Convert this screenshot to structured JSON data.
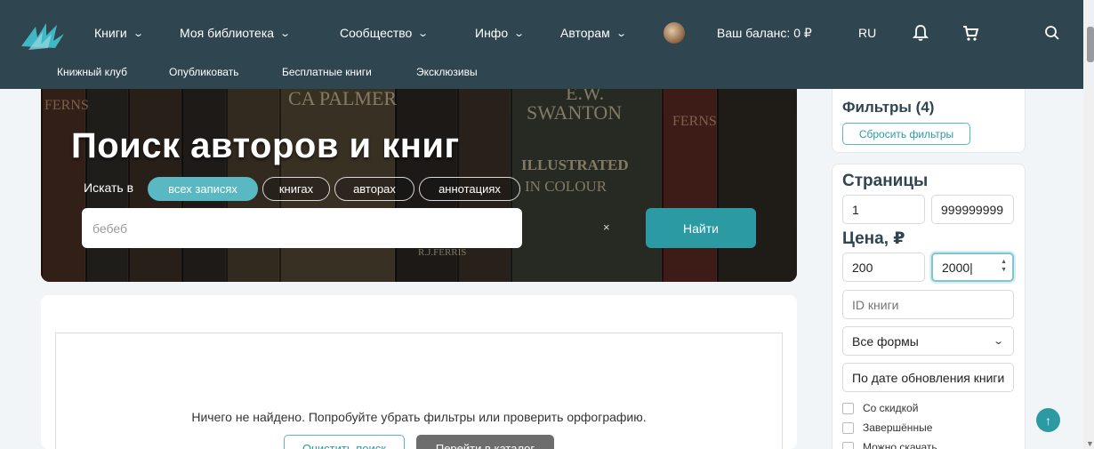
{
  "nav": {
    "items": [
      {
        "label": "Книги"
      },
      {
        "label": "Моя библиотека"
      },
      {
        "label": "Сообщество"
      },
      {
        "label": "Инфо"
      },
      {
        "label": "Авторам"
      }
    ],
    "balance": "Ваш баланс: 0 ₽",
    "lang": "RU"
  },
  "subnav": [
    "Книжный клуб",
    "Опубликовать",
    "Бесплатные книги",
    "Эксклюзивы"
  ],
  "hero": {
    "title": "Поиск авторов и книг",
    "search_in_label": "Искать в",
    "chips": [
      {
        "label": "всех записях",
        "active": true
      },
      {
        "label": "книгах",
        "active": false
      },
      {
        "label": "авторах",
        "active": false
      },
      {
        "label": "аннотациях",
        "active": false
      }
    ],
    "query": "бебеб",
    "clear": "×",
    "find_button": "Найти",
    "book_spines": [
      "CA PALMER",
      "E.W.",
      "SWANTON",
      "ILLUSTRATED",
      "IN COLOUR",
      "FERNS",
      "FERNS",
      "R.J.FERRIS"
    ]
  },
  "results": {
    "empty_message": "Ничего не найдено. Попробуйте убрать фильтры или проверить орфографию.",
    "clear_search": "Очистить поиск",
    "go_catalog": "Перейти в каталог"
  },
  "sidebar": {
    "filters_title": "Фильтры (4)",
    "reset_filters": "Сбросить фильтры",
    "pages_title": "Страницы",
    "pages_from": "1",
    "pages_to": "999999999",
    "price_title": "Цена, ₽",
    "price_from": "200",
    "price_to": "2000",
    "book_id_placeholder": "ID книги",
    "forms_select": "Все формы",
    "sort_select": "По дате обновления книги",
    "checkboxes": [
      "Со скидкой",
      "Завершённые",
      "Можно скачать"
    ]
  },
  "colors": {
    "navbar": "#2f4550",
    "accent": "#2b9aa3",
    "chip_active": "#5ab8c2",
    "grey_button": "#6d6d6d"
  }
}
